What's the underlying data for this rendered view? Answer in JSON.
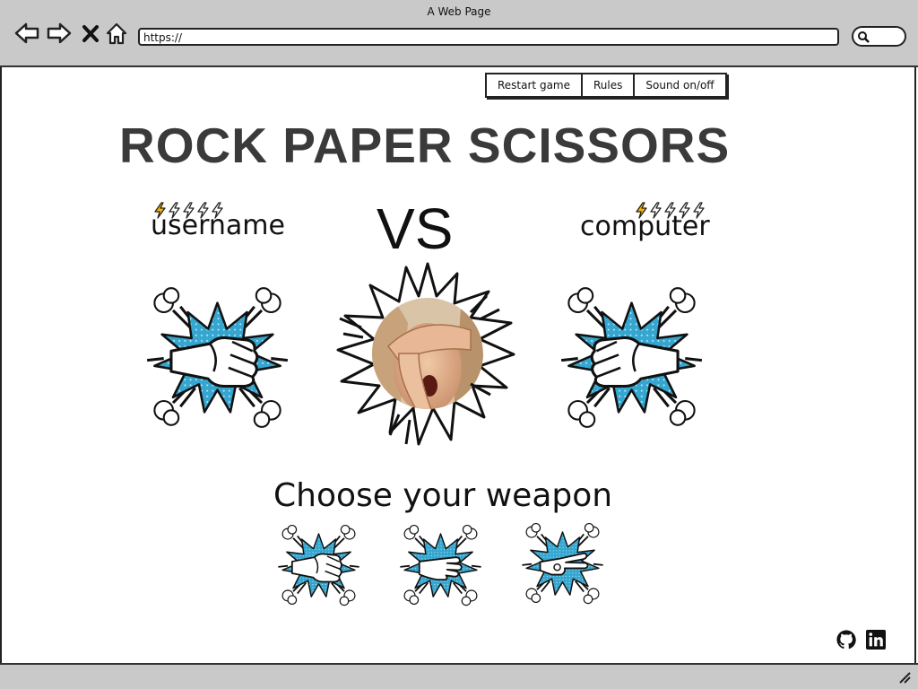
{
  "window": {
    "title": "A Web Page"
  },
  "browser": {
    "url": "https://",
    "nav_icons": [
      "back-arrow-icon",
      "forward-arrow-icon",
      "close-x-icon",
      "home-icon"
    ],
    "search_icon": "search-icon"
  },
  "menu": {
    "items": [
      {
        "label": "Restart game"
      },
      {
        "label": "Rules"
      },
      {
        "label": "Sound on/off"
      }
    ]
  },
  "game": {
    "title": "ROCK PAPER SCISSORS",
    "vs": "VS",
    "player": {
      "name": "username",
      "lives_total": 5,
      "lives_remaining": 1
    },
    "computer": {
      "name": "computer",
      "lives_total": 5,
      "lives_remaining": 1
    },
    "player_choice": "rock",
    "computer_choice": "rock",
    "center_image": "facepalm-photo"
  },
  "weapons": {
    "heading": "Choose your weapon",
    "options": [
      "rock",
      "paper",
      "scissors"
    ]
  },
  "footer": {
    "icons": [
      "github-icon",
      "linkedin-icon"
    ]
  },
  "colors": {
    "burst": "#35a6cf",
    "bolt_active": "#f4b400",
    "chrome": "#c9c9c9"
  }
}
